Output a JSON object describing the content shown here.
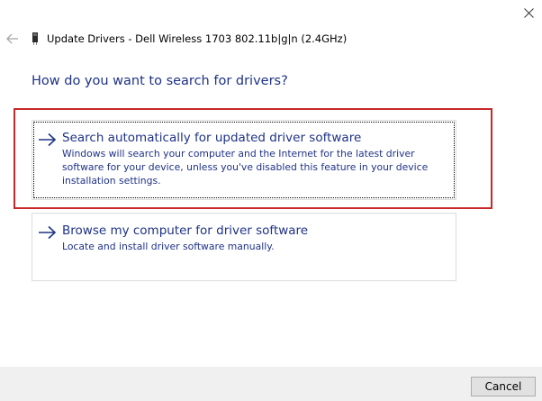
{
  "window": {
    "header_title": "Update Drivers - Dell Wireless 1703 802.11b|g|n (2.4GHz)"
  },
  "icons": {
    "close": "close-icon",
    "back": "back-arrow-icon",
    "device": "network-device-icon",
    "option_arrow": "right-arrow-icon"
  },
  "colors": {
    "link_blue": "#1e3287",
    "highlight_red": "#c8282a",
    "footer_bg": "#f0f0f0"
  },
  "main": {
    "question": "How do you want to search for drivers?",
    "options": [
      {
        "title": "Search automatically for updated driver software",
        "description": "Windows will search your computer and the Internet for the latest driver software for your device, unless you've disabled this feature in your device installation settings."
      },
      {
        "title": "Browse my computer for driver software",
        "description": "Locate and install driver software manually."
      }
    ]
  },
  "footer": {
    "cancel_label": "Cancel"
  }
}
